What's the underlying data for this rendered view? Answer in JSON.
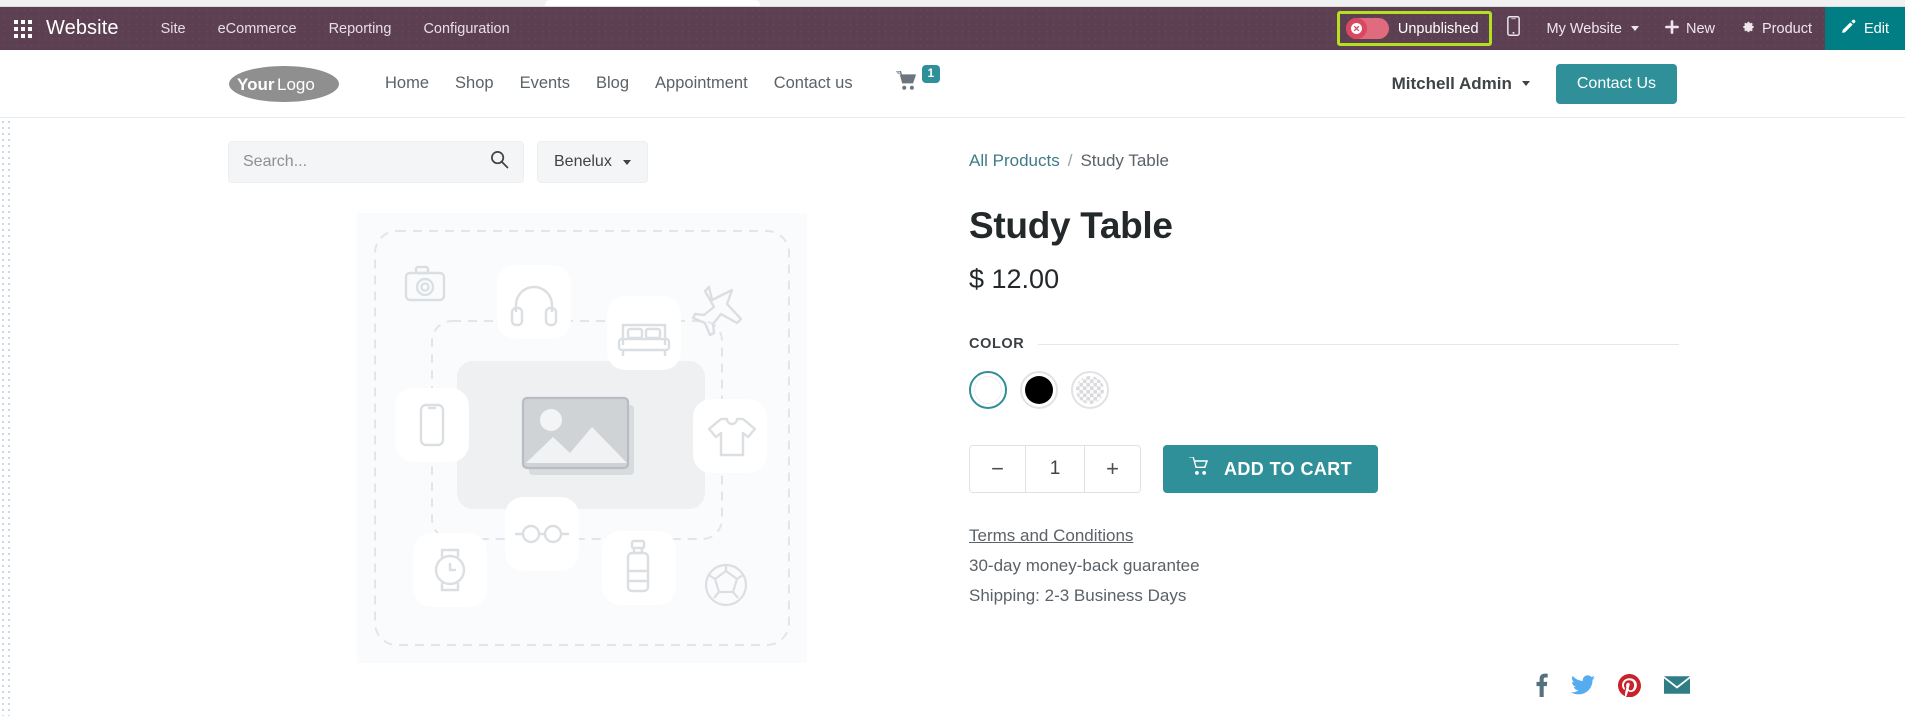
{
  "app": {
    "name": "Website",
    "apps_icon": "apps-grid-icon",
    "menus": [
      "Site",
      "eCommerce",
      "Reporting",
      "Configuration"
    ],
    "publish": {
      "status_label": "Unpublished",
      "toggle_state": "off",
      "toggle_icon": "close-circle-icon",
      "highlight_color": "#b4e01f",
      "toggle_color": "#d9485f"
    },
    "mobile_preview_icon": "mobile-icon",
    "website_selector": "My Website",
    "new_label": "New",
    "new_icon": "plus-icon",
    "product_label": "Product",
    "product_icon": "gear-icon",
    "edit_label": "Edit",
    "edit_icon": "pencil-icon",
    "bar_color": "#5c4052",
    "accent_color": "#017e84"
  },
  "site_header": {
    "logo_text_1": "Your",
    "logo_text_2": "Logo",
    "nav": [
      "Home",
      "Shop",
      "Events",
      "Blog",
      "Appointment",
      "Contact us"
    ],
    "cart_icon": "shopping-cart-icon",
    "cart_count": "1",
    "user_name": "Mitchell Admin",
    "cta_label": "Contact Us"
  },
  "shop_toolbar": {
    "search_placeholder": "Search...",
    "search_value": "",
    "search_icon": "search-icon",
    "pricelist_label": "Benelux"
  },
  "breadcrumb": {
    "parent": "All Products",
    "separator": "/",
    "current": "Study Table"
  },
  "product": {
    "name": "Study Table",
    "price": "$ 12.00",
    "attribute_label": "COLOR",
    "swatches": [
      {
        "name": "white",
        "color": "#ffffff",
        "selected": true
      },
      {
        "name": "black",
        "color": "#000000",
        "selected": false
      },
      {
        "name": "transparent",
        "color": "checker",
        "selected": false
      }
    ],
    "quantity": "1",
    "decrease_label": "−",
    "increase_label": "+",
    "add_to_cart_label": "ADD TO CART",
    "cart_icon": "shopping-cart-icon",
    "terms_link": "Terms and Conditions",
    "guarantee": "30-day money-back guarantee",
    "shipping": "Shipping: 2-3 Business Days",
    "image_placeholder_icons": [
      "camera-icon",
      "headphones-icon",
      "bed-icon",
      "airplane-icon",
      "smartphone-icon",
      "image-icon",
      "tshirt-icon",
      "glasses-icon",
      "watch-icon",
      "bottle-icon",
      "soccer-ball-icon"
    ]
  },
  "social": [
    {
      "name": "facebook-icon",
      "color": "#55707f"
    },
    {
      "name": "twitter-icon",
      "color": "#55acee"
    },
    {
      "name": "pinterest-icon",
      "color": "#c8232c"
    },
    {
      "name": "email-icon",
      "color": "#2f7e86"
    }
  ]
}
